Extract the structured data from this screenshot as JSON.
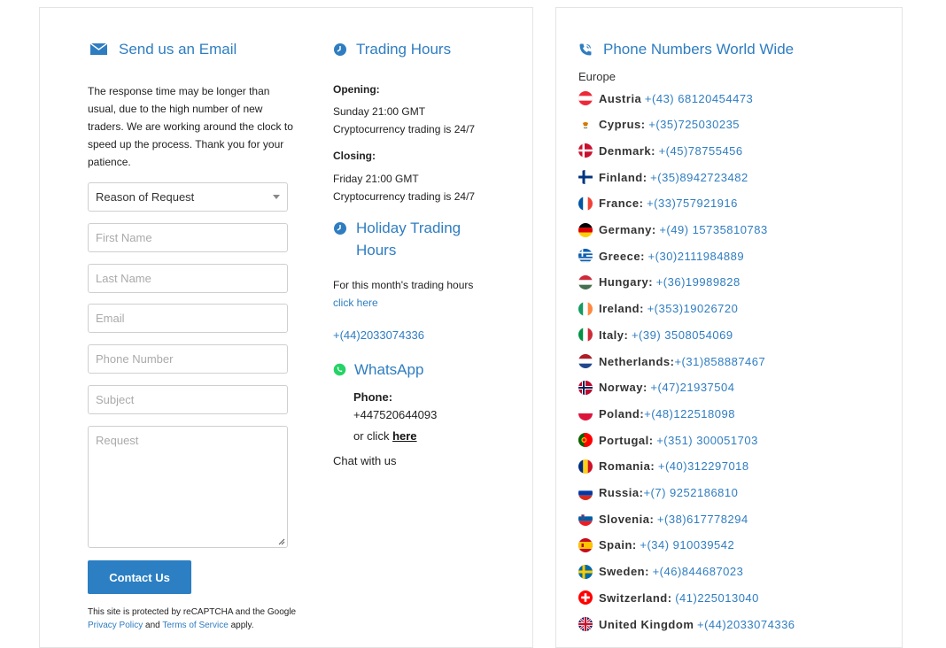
{
  "email_section": {
    "title": "Send us an Email",
    "description": "The response time may be longer than usual, due to the high number of new traders. We are working around the clock to speed up the process. Thank you for your patience.",
    "reason_select": "Reason of Request",
    "first_name_placeholder": "First Name",
    "last_name_placeholder": "Last Name",
    "email_placeholder": "Email",
    "phone_placeholder": "Phone Number",
    "subject_placeholder": "Subject",
    "request_placeholder": "Request",
    "submit_label": "Contact Us",
    "recaptcha_prefix": "This site is protected by reCAPTCHA and the Google",
    "privacy_label": "Privacy Policy",
    "and_text": "and",
    "terms_label": "Terms of Service",
    "apply_text": "apply."
  },
  "trading_hours": {
    "title": "Trading Hours",
    "opening_label": "Opening:",
    "opening_time": "Sunday 21:00 GMT",
    "opening_crypto": "Cryptocurrency trading is 24/7",
    "closing_label": "Closing:",
    "closing_time": "Friday 21:00 GMT",
    "closing_crypto": "Cryptocurrency trading is 24/7"
  },
  "holiday_hours": {
    "title_line1": "Holiday Trading",
    "title_line2": "Hours",
    "text": "For this month's trading hours",
    "link": "click here",
    "phone": "+(44)2033074336"
  },
  "whatsapp": {
    "title": "WhatsApp",
    "phone_label": "Phone:",
    "phone_number": "+447520644093",
    "or_click": "or click",
    "here_link": "here",
    "chat": "Chat with us"
  },
  "phone_numbers": {
    "title": "Phone Numbers World Wide",
    "region": "Europe",
    "countries": [
      {
        "name": "Austria",
        "number": "+(43) 68120454473",
        "flag": "austria-flag"
      },
      {
        "name": "Cyprus:",
        "number": "+(35)725030235",
        "flag": "cyprus-flag"
      },
      {
        "name": "Denmark:",
        "number": "+(45)78755456",
        "flag": "denmark-flag"
      },
      {
        "name": "Finland:",
        "number": "+(35)8942723482",
        "flag": "finland-flag"
      },
      {
        "name": "France:",
        "number": "+(33)757921916",
        "flag": "france-flag"
      },
      {
        "name": "Germany:",
        "number": "+(49) 15735810783",
        "flag": "germany-flag"
      },
      {
        "name": "Greece:",
        "number": "+(30)2111984889",
        "flag": "greece-flag"
      },
      {
        "name": "Hungary:",
        "number": "+(36)19989828",
        "flag": "hungary-flag"
      },
      {
        "name": "Ireland:",
        "number": "+(353)19026720",
        "flag": "ireland-flag"
      },
      {
        "name": "Italy:",
        "number": "+(39) 3508054069",
        "flag": "italy-flag"
      },
      {
        "name": "Netherlands:",
        "number": "+(31)858887467",
        "flag": "netherlands-flag"
      },
      {
        "name": "Norway:",
        "number": "+(47)21937504",
        "flag": "norway-flag"
      },
      {
        "name": "Poland:",
        "number": "+(48)122518098",
        "flag": "poland-flag"
      },
      {
        "name": "Portugal:",
        "number": "+(351) 300051703",
        "flag": "portugal-flag"
      },
      {
        "name": "Romania:",
        "number": "+(40)312297018",
        "flag": "romania-flag"
      },
      {
        "name": "Russia:",
        "number": "+(7) 9252186810",
        "flag": "russia-flag"
      },
      {
        "name": "Slovenia:",
        "number": "+(38)617778294",
        "flag": "slovenia-flag"
      },
      {
        "name": "Spain:",
        "number": "+(34) 910039542",
        "flag": "spain-flag"
      },
      {
        "name": "Sweden:",
        "number": "+(46)844687023",
        "flag": "sweden-flag"
      },
      {
        "name": "Switzerland:",
        "number": "(41)225013040",
        "flag": "switzerland-flag"
      },
      {
        "name": "United Kingdom",
        "number": "+(44)2033074336",
        "flag": "uk-flag"
      }
    ]
  },
  "colors": {
    "accent": "#2f7dc1",
    "button": "#2b7fc2",
    "whatsapp": "#25d366"
  }
}
